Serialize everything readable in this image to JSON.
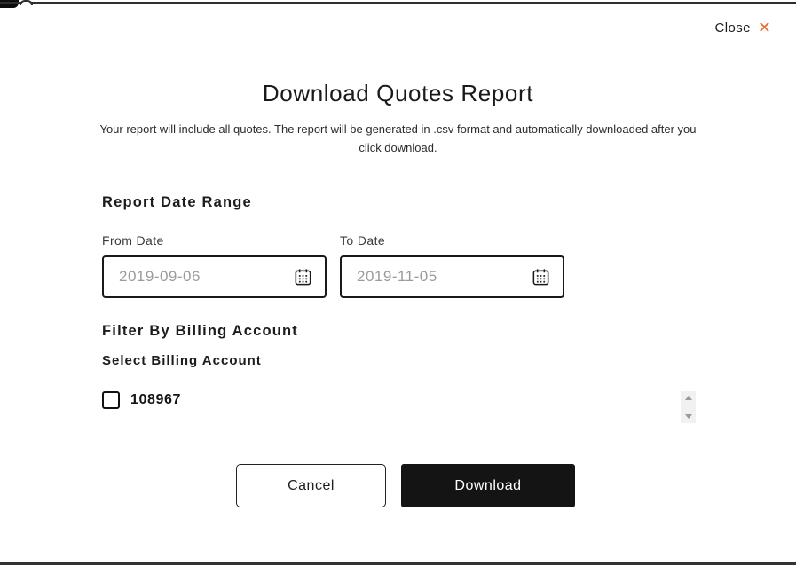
{
  "window": {
    "close_label": "Close",
    "close_icon": "✕"
  },
  "modal": {
    "title": "Download Quotes Report",
    "description": "Your report will include all quotes. The report will be generated in .csv format and automatically downloaded after you click download.",
    "date_range": {
      "heading": "Report Date Range",
      "from_label": "From Date",
      "from_value": "2019-09-06",
      "to_label": "To Date",
      "to_value": "2019-11-05"
    },
    "billing_filter": {
      "heading": "Filter By Billing Account",
      "subheading": "Select Billing Account",
      "accounts": [
        {
          "id": "108967",
          "checked": false
        }
      ]
    },
    "actions": {
      "cancel_label": "Cancel",
      "download_label": "Download"
    }
  },
  "icons": {
    "close": "close-icon",
    "calendar": "calendar-icon",
    "scroll_up": "chevron-up-icon",
    "scroll_down": "chevron-down-icon"
  },
  "colors": {
    "accent_orange": "#F0672B",
    "button_black": "#141414",
    "placeholder_gray": "#9B9B9B",
    "scrollbar_gray": "#F1F1F1"
  }
}
